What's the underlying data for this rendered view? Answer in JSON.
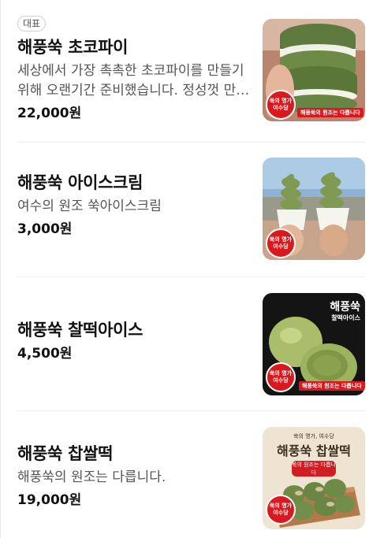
{
  "menu": {
    "items": [
      {
        "badge": "대표",
        "name": "해풍쑥 초코파이",
        "description": "세상에서 가장 촉촉한 초코파이를 만들기 위해 오랜기간 준비했습니다. 정성껏 만들었습니다.",
        "price": "22,000원",
        "image": {
          "stamp": "쑥의 명가 여수당",
          "ribbon": "해풍쑥의 원조는 다릅니다"
        }
      },
      {
        "name": "해풍쑥 아이스크림",
        "description": "여수의 원조 쑥아이스크림",
        "price": "3,000원",
        "image": {
          "stamp": "쑥의 명가 여수당"
        }
      },
      {
        "name": "해풍쑥 찰떡아이스",
        "price": "4,500원",
        "image": {
          "title": "해풍쑥",
          "subtitle": "찰떡아이스",
          "stamp": "쑥의 명가 여수당",
          "ribbon": "해풍쑥의 원조는 다릅니다"
        }
      },
      {
        "name": "해풍쑥 찹쌀떡",
        "description": "해풍쑥의 원조는 다릅니다.",
        "price": "19,000원",
        "image": {
          "top_text": "쑥의 명가, 여수당",
          "title": "해풍쑥 찹쌀떡",
          "pill": "쑥의 원조는 다릅니다",
          "stamp": "쑥의 명가 여수당"
        }
      }
    ]
  },
  "colors": {
    "stamp_red": "#d9191d",
    "mugwort_green": "#6f8a4a",
    "text_primary": "#111111",
    "text_secondary": "#555555"
  }
}
